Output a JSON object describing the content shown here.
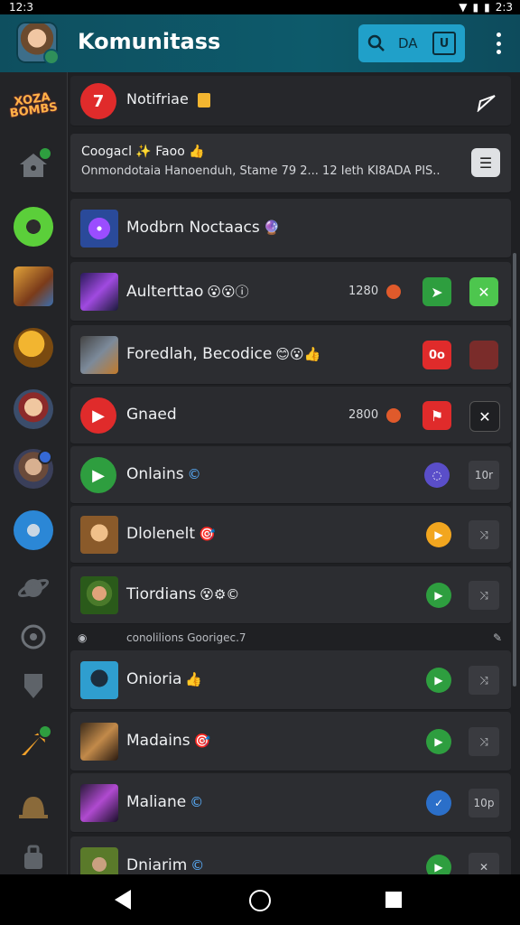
{
  "status": {
    "time": "12:3",
    "right_text": "2:3"
  },
  "appbar": {
    "title": "Komunitass",
    "search_label": "DA",
    "badge": "U"
  },
  "notification_header": {
    "title": "Notifriae"
  },
  "info_card": {
    "title": "Coogacl ✨ Faoo 👍",
    "subtitle": "Onmondotaia Hanoenduh, Stame 79 2... 12 Ieth KI8ADA PIS..."
  },
  "rows": [
    {
      "title": "Modbrn Noctaacs",
      "emoji": "🔮"
    },
    {
      "title": "Aulterttao",
      "emoji": "😮😮ⓘ",
      "num": "1280"
    },
    {
      "title": "Foredlah, Becodice",
      "emoji": "😊😮👍"
    },
    {
      "title": "Gnaed",
      "num": "2800"
    },
    {
      "title": "Onlains",
      "emoji": "©"
    },
    {
      "title": "Dlolenelt",
      "emoji": "🎯"
    },
    {
      "title": "Tiordians",
      "emoji": "😵⚙︎©"
    },
    {
      "title": "Onioria",
      "emoji": "👍"
    },
    {
      "title": "Madains",
      "emoji": "🎯"
    },
    {
      "title": "Maliane",
      "emoji": "©"
    },
    {
      "title": "Dniarim",
      "emoji": "©"
    }
  ],
  "divider": {
    "text": "conolilions Goorigec.7"
  },
  "action_labels": {
    "a1": "0o",
    "b1": "10r",
    "b2": "10p",
    "x": "✕"
  },
  "colors": {
    "accent": "#20a0c9",
    "appbar": "#0d5a6b",
    "green": "#2e9e3f",
    "red": "#e02b2b"
  }
}
